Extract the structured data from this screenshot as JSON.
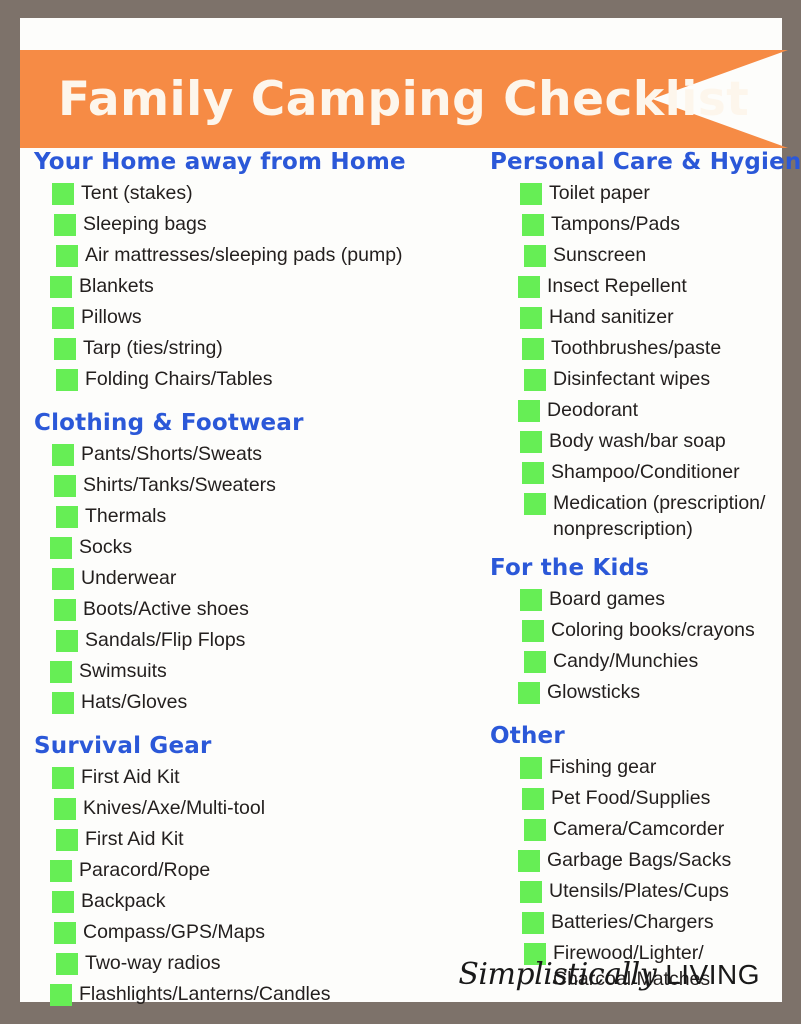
{
  "banner": {
    "title": "Family Camping Checklist",
    "background_color": "#F68B45",
    "text_color": "#FDF6EC"
  },
  "theme": {
    "frame_color": "#7D726A",
    "page_color": "#FDFDFB",
    "heading_color": "#2B58D8",
    "checkbox_color": "#66EE55",
    "item_text_color": "#231F1E"
  },
  "logo": {
    "script": "Simplistically",
    "caps": "LIVING"
  },
  "left_column": {
    "sections": [
      {
        "title": "Your Home away from Home",
        "items": [
          "Tent (stakes)",
          "Sleeping bags",
          "Air mattresses/sleeping pads (pump)",
          "Blankets",
          "Pillows",
          "Tarp (ties/string)",
          "Folding Chairs/Tables"
        ]
      },
      {
        "title": "Clothing & Footwear",
        "items": [
          "Pants/Shorts/Sweats",
          "Shirts/Tanks/Sweaters",
          "Thermals",
          "Socks",
          "Underwear",
          "Boots/Active shoes",
          "Sandals/Flip Flops",
          "Swimsuits",
          "Hats/Gloves"
        ]
      },
      {
        "title": "Survival Gear",
        "items": [
          "First Aid Kit",
          "Knives/Axe/Multi-tool",
          "First Aid Kit",
          "Paracord/Rope",
          "Backpack",
          "Compass/GPS/Maps",
          "Two-way radios",
          "Flashlights/Lanterns/Candles"
        ]
      }
    ]
  },
  "right_column": {
    "sections": [
      {
        "title": "Personal Care & Hygiene",
        "items": [
          "Toilet paper",
          "Tampons/Pads",
          "Sunscreen",
          "Insect Repellent",
          "Hand sanitizer",
          "Toothbrushes/paste",
          "Disinfectant wipes",
          "Deodorant",
          "Body wash/bar soap",
          "Shampoo/Conditioner",
          "Medication (prescription/\nnonprescription)"
        ]
      },
      {
        "title": "For the Kids",
        "items": [
          "Board games",
          "Coloring books/crayons",
          "Candy/Munchies",
          "Glowsticks"
        ]
      },
      {
        "title": "Other",
        "items": [
          "Fishing gear",
          "Pet Food/Supplies",
          "Camera/Camcorder",
          "Garbage Bags/Sacks",
          "Utensils/Plates/Cups",
          "Batteries/Chargers",
          "Firewood/Lighter/\nCharcoal/Matches"
        ]
      }
    ]
  }
}
